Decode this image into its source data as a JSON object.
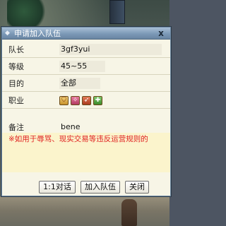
{
  "dialog": {
    "title": "申请加入队伍",
    "close_glyph": "x"
  },
  "form": {
    "leader_label": "队长",
    "leader_value": "3gf3yui",
    "level_label": "等级",
    "level_value": "45~55",
    "purpose_label": "目的",
    "purpose_value": "全部",
    "class_label": "职业",
    "class_icons": [
      "warrior-class-icon",
      "mage-class-icon",
      "archer-class-icon",
      "healer-class-icon"
    ],
    "note_label": "备注",
    "note_value": "bene",
    "warning": "※如用于辱骂、现实交易等违反运营规则的"
  },
  "buttons": {
    "chat": "1:1对话",
    "join": "加入队伍",
    "close": "关闭"
  },
  "colors": {
    "titlebar": "#7996b4",
    "warning_text": "#e02020",
    "dialog_bg": "#f7f5e6"
  }
}
